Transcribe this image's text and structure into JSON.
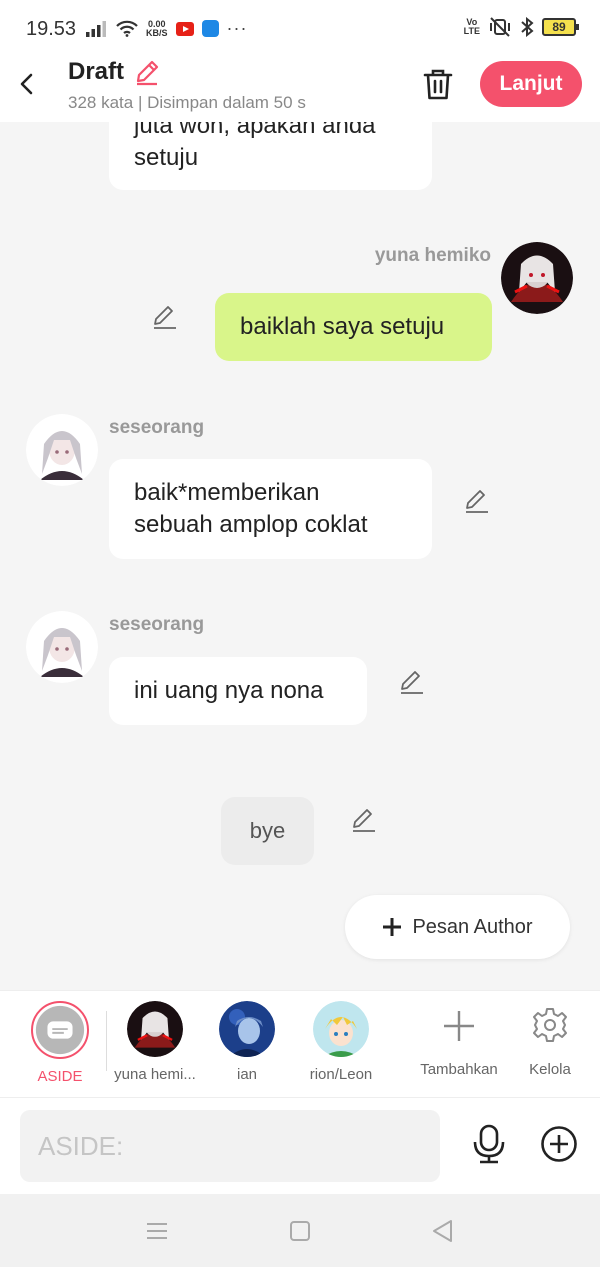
{
  "status_bar": {
    "time": "19.53",
    "net_speed_value": "0.00",
    "net_speed_unit": "KB/S",
    "volte": "Vo\nLTE",
    "battery": "89"
  },
  "header": {
    "title": "Draft",
    "meta": "328 kata | Disimpan dalam 50 s",
    "next_label": "Lanjut"
  },
  "messages": [
    {
      "lines": [
        "juta won, apakah anda",
        "setuju"
      ]
    },
    {
      "name": "yuna hemiko",
      "lines": [
        "baiklah saya setuju"
      ]
    },
    {
      "name": "seseorang",
      "lines": [
        "baik*memberikan",
        "sebuah amplop coklat"
      ]
    },
    {
      "name": "seseorang",
      "lines": [
        "ini uang nya nona"
      ]
    },
    {
      "lines": [
        "bye"
      ]
    }
  ],
  "author_button": {
    "label": "Pesan Author"
  },
  "characters": [
    {
      "label": "ASIDE"
    },
    {
      "label": "yuna hemi..."
    },
    {
      "label": "ian"
    },
    {
      "label": "rion/Leon"
    },
    {
      "label": "Tambahkan"
    },
    {
      "label": "Kelola"
    }
  ],
  "input": {
    "placeholder": "ASIDE:"
  },
  "colors": {
    "accent": "#f4516c",
    "self_bubble": "#d9f58a",
    "aside_bubble": "#ececec",
    "background": "#f5f5f5"
  }
}
